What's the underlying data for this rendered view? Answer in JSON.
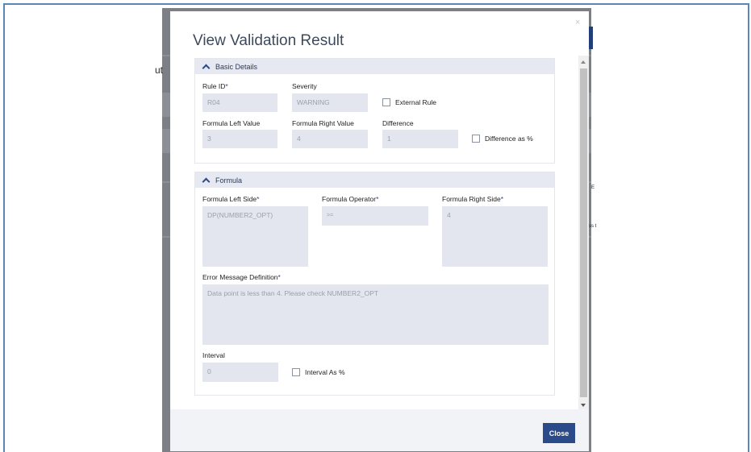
{
  "modal": {
    "title": "View Validation Result",
    "close_glyph": "×",
    "close_button": "Close"
  },
  "basic_details": {
    "header": "Basic Details",
    "rule_id_label": "Rule ID",
    "rule_id_value": "R04",
    "severity_label": "Severity",
    "severity_value": "WARNING",
    "external_rule_label": "External Rule",
    "formula_left_value_label": "Formula Left Value",
    "formula_left_value": "3",
    "formula_right_value_label": "Formula Right Value",
    "formula_right_value": "4",
    "difference_label": "Difference",
    "difference_value": "1",
    "difference_pct_label": "Difference as %"
  },
  "formula": {
    "header": "Formula",
    "left_side_label": "Formula Left Side",
    "left_side_value": "DP(NUMBER2_OPT)",
    "operator_label": "Formula Operator",
    "operator_value": ">=",
    "right_side_label": "Formula Right Side",
    "right_side_value": "4",
    "error_label": "Error Message Definition",
    "error_value": "Data point is less than 4. Please check NUMBER2_OPT",
    "interval_label": "Interval",
    "interval_value": "0",
    "interval_pct_label": "Interval As %"
  },
  "required_marker": "*",
  "background": {
    "frag_ut": "ut",
    "frag_e": "E",
    "frag_ss": "ss t"
  },
  "colors": {
    "accent": "#2b4a8a",
    "field_bg": "#e3e6ef",
    "section_header_bg": "#e6e9f2",
    "overlay": "#7c7f84"
  }
}
